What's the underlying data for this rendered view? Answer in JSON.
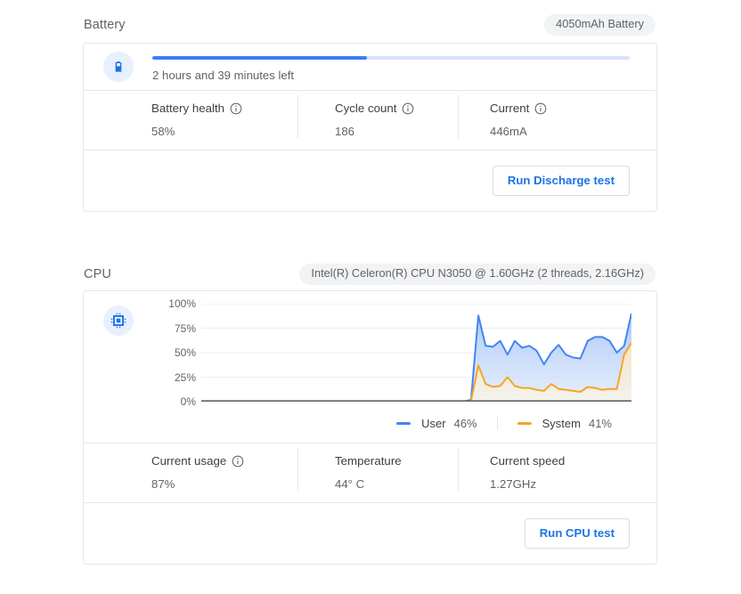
{
  "battery": {
    "section_title": "Battery",
    "chip": "4050mAh Battery",
    "icon": "battery-icon",
    "progress_label": "2 hours and 39 minutes left",
    "progress_percent": 45,
    "stats": [
      {
        "label": "Battery health",
        "value": "58%",
        "has_info": true
      },
      {
        "label": "Cycle count",
        "value": "186",
        "has_info": true
      },
      {
        "label": "Current",
        "value": "446mA",
        "has_info": true
      }
    ],
    "button": "Run Discharge test"
  },
  "cpu": {
    "section_title": "CPU",
    "chip": "Intel(R) Celeron(R) CPU N3050 @ 1.60GHz (2 threads, 2.16GHz)",
    "icon": "cpu-chip-icon",
    "stats": [
      {
        "label": "Current usage",
        "value": "87%",
        "has_info": true
      },
      {
        "label": "Temperature",
        "value": "44° C",
        "has_info": false
      },
      {
        "label": "Current speed",
        "value": "1.27GHz",
        "has_info": false
      }
    ],
    "button": "Run CPU test"
  },
  "colors": {
    "user_series": "#4285f4",
    "system_series": "#f5a623",
    "accent": "#1a73e8",
    "progress_fill": "#3b7df6",
    "progress_track": "#d6e2fb",
    "chip_bg": "#f1f3f4",
    "card_border": "#e4e6e8",
    "icon_badge_bg": "#e8f0fe",
    "text_primary": "#3c4043",
    "text_secondary": "#5f6368",
    "axis_line": "#5f6368",
    "gridline": "#ededed"
  },
  "chart_data": {
    "type": "area",
    "title": "",
    "xlabel": "",
    "ylabel": "",
    "ylim": [
      0,
      100
    ],
    "ytick_labels": [
      "100%",
      "75%",
      "50%",
      "25%",
      "0%"
    ],
    "yticks": [
      100,
      75,
      50,
      25,
      0
    ],
    "grid": true,
    "legend_position": "bottom-right",
    "x_axis_visible": true,
    "x_tick_labels": [],
    "n_points": 60,
    "data_start_index": 37,
    "series": [
      {
        "name": "User",
        "label": "User",
        "current": "46%",
        "color": "#4285f4",
        "values": [
          0,
          0,
          0,
          0,
          0,
          0,
          0,
          0,
          0,
          0,
          0,
          0,
          0,
          0,
          0,
          0,
          0,
          0,
          0,
          0,
          0,
          0,
          0,
          0,
          0,
          0,
          0,
          0,
          0,
          0,
          0,
          0,
          0,
          0,
          0,
          0,
          0,
          2,
          88,
          57,
          56,
          62,
          48,
          62,
          55,
          57,
          52,
          38,
          50,
          58,
          48,
          45,
          44,
          62,
          66,
          66,
          62,
          50,
          57,
          90
        ]
      },
      {
        "name": "System",
        "label": "System",
        "current": "41%",
        "color": "#f5a623",
        "values": [
          0,
          0,
          0,
          0,
          0,
          0,
          0,
          0,
          0,
          0,
          0,
          0,
          0,
          0,
          0,
          0,
          0,
          0,
          0,
          0,
          0,
          0,
          0,
          0,
          0,
          0,
          0,
          0,
          0,
          0,
          0,
          0,
          0,
          0,
          0,
          0,
          0,
          1,
          37,
          18,
          15,
          16,
          25,
          16,
          14,
          14,
          12,
          11,
          18,
          13,
          12,
          11,
          10,
          15,
          14,
          12,
          13,
          13,
          48,
          60
        ]
      }
    ]
  }
}
